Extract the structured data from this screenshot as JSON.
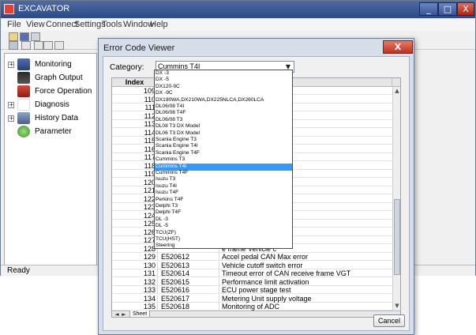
{
  "app": {
    "title": "EXCAVATOR",
    "window_buttons": {
      "min": "_",
      "max": "□",
      "close": "X"
    },
    "menu": [
      "File",
      "View",
      "Connect",
      "Settings",
      "Tools",
      "Window",
      "Help"
    ],
    "status": "Ready"
  },
  "tree": [
    {
      "label": "Monitoring",
      "icon": "monitor-icon",
      "expandable": true
    },
    {
      "label": "Graph Output",
      "icon": "graph-icon",
      "expandable": false
    },
    {
      "label": "Force Operation",
      "icon": "force-operation-icon",
      "expandable": false
    },
    {
      "label": "Diagnosis",
      "icon": "diagnosis-icon",
      "expandable": true
    },
    {
      "label": "History Data",
      "icon": "history-icon",
      "expandable": true
    },
    {
      "label": "Parameter",
      "icon": "parameter-icon",
      "expandable": false
    }
  ],
  "dialog": {
    "title": "Error Code Viewer",
    "close_label": "X",
    "category_label": "Category:",
    "category_value": "Cummins T4I",
    "cancel_label": "Cancel",
    "sheet_tab": "Sheet 1",
    "column_index": "Index"
  },
  "rows": [
    {
      "index": "109",
      "code": "",
      "desc": "fuel temperature"
    },
    {
      "index": "110",
      "code": "",
      "desc": ""
    },
    {
      "index": "111",
      "code": "",
      "desc": ""
    },
    {
      "index": "112",
      "code": "",
      "desc": ""
    },
    {
      "index": "113",
      "code": "",
      "desc": ""
    },
    {
      "index": "114",
      "code": "",
      "desc": ""
    },
    {
      "index": "115",
      "code": "",
      "desc": ""
    },
    {
      "index": "116",
      "code": "",
      "desc": ""
    },
    {
      "index": "117",
      "code": "",
      "desc": "A"
    },
    {
      "index": "118",
      "code": "",
      "desc": "plausibility"
    },
    {
      "index": "119",
      "code": "",
      "desc": "N time out"
    },
    {
      "index": "120",
      "code": "",
      "desc": "e frame DEC1V"
    },
    {
      "index": "121",
      "code": "",
      "desc": "rror"
    },
    {
      "index": "122",
      "code": "",
      "desc": ""
    },
    {
      "index": "123",
      "code": "",
      "desc": "e frame EGR Valv"
    },
    {
      "index": "124",
      "code": "",
      "desc": ""
    },
    {
      "index": "125",
      "code": "",
      "desc": "tuator"
    },
    {
      "index": "126",
      "code": "",
      "desc": "error"
    },
    {
      "index": "127",
      "code": "",
      "desc": "ater"
    },
    {
      "index": "128",
      "code": "",
      "desc": "e frame Vehicle c"
    },
    {
      "index": "129",
      "code": "E520612",
      "desc": "Accel pedal CAN Max error"
    },
    {
      "index": "130",
      "code": "E520613",
      "desc": "Vehicle cutoff switch error"
    },
    {
      "index": "131",
      "code": "E520614",
      "desc": "Timeout error of CAN receive frame VGT"
    },
    {
      "index": "132",
      "code": "E520615",
      "desc": "Performance limit activation"
    },
    {
      "index": "133",
      "code": "E520616",
      "desc": "ECU power stage test"
    },
    {
      "index": "134",
      "code": "E520617",
      "desc": "Metering Unit supply voltage"
    },
    {
      "index": "135",
      "code": "E520618",
      "desc": "Monitoring of ADC"
    }
  ],
  "dropdown": {
    "selected_index": 16,
    "options": [
      "DX -3",
      "DX -5",
      "DX120-9C",
      "DX -9C",
      "DX190WA,DX210WA,DX225NLCA,DX260LCA",
      "DL06/08 T4I",
      "DL06/08 T4F",
      "DL06/08 T3",
      "DL08 T3 DX Model",
      "DL06 T3 DX Model",
      "Scania Engine T3",
      "Scania Engine T4I",
      "Scania Engine T4F",
      "Cummins T3",
      "Cummins T4I",
      "Cummins T4F",
      "Isuzu T3",
      "Isuzu T4I",
      "Isuzu T4F",
      "Perkins T4F",
      "Delphi T3",
      "Delphi T4F",
      "DL -3",
      "DL -5",
      "TCU(ZF)",
      "TCU(HST)",
      "Steering"
    ]
  }
}
